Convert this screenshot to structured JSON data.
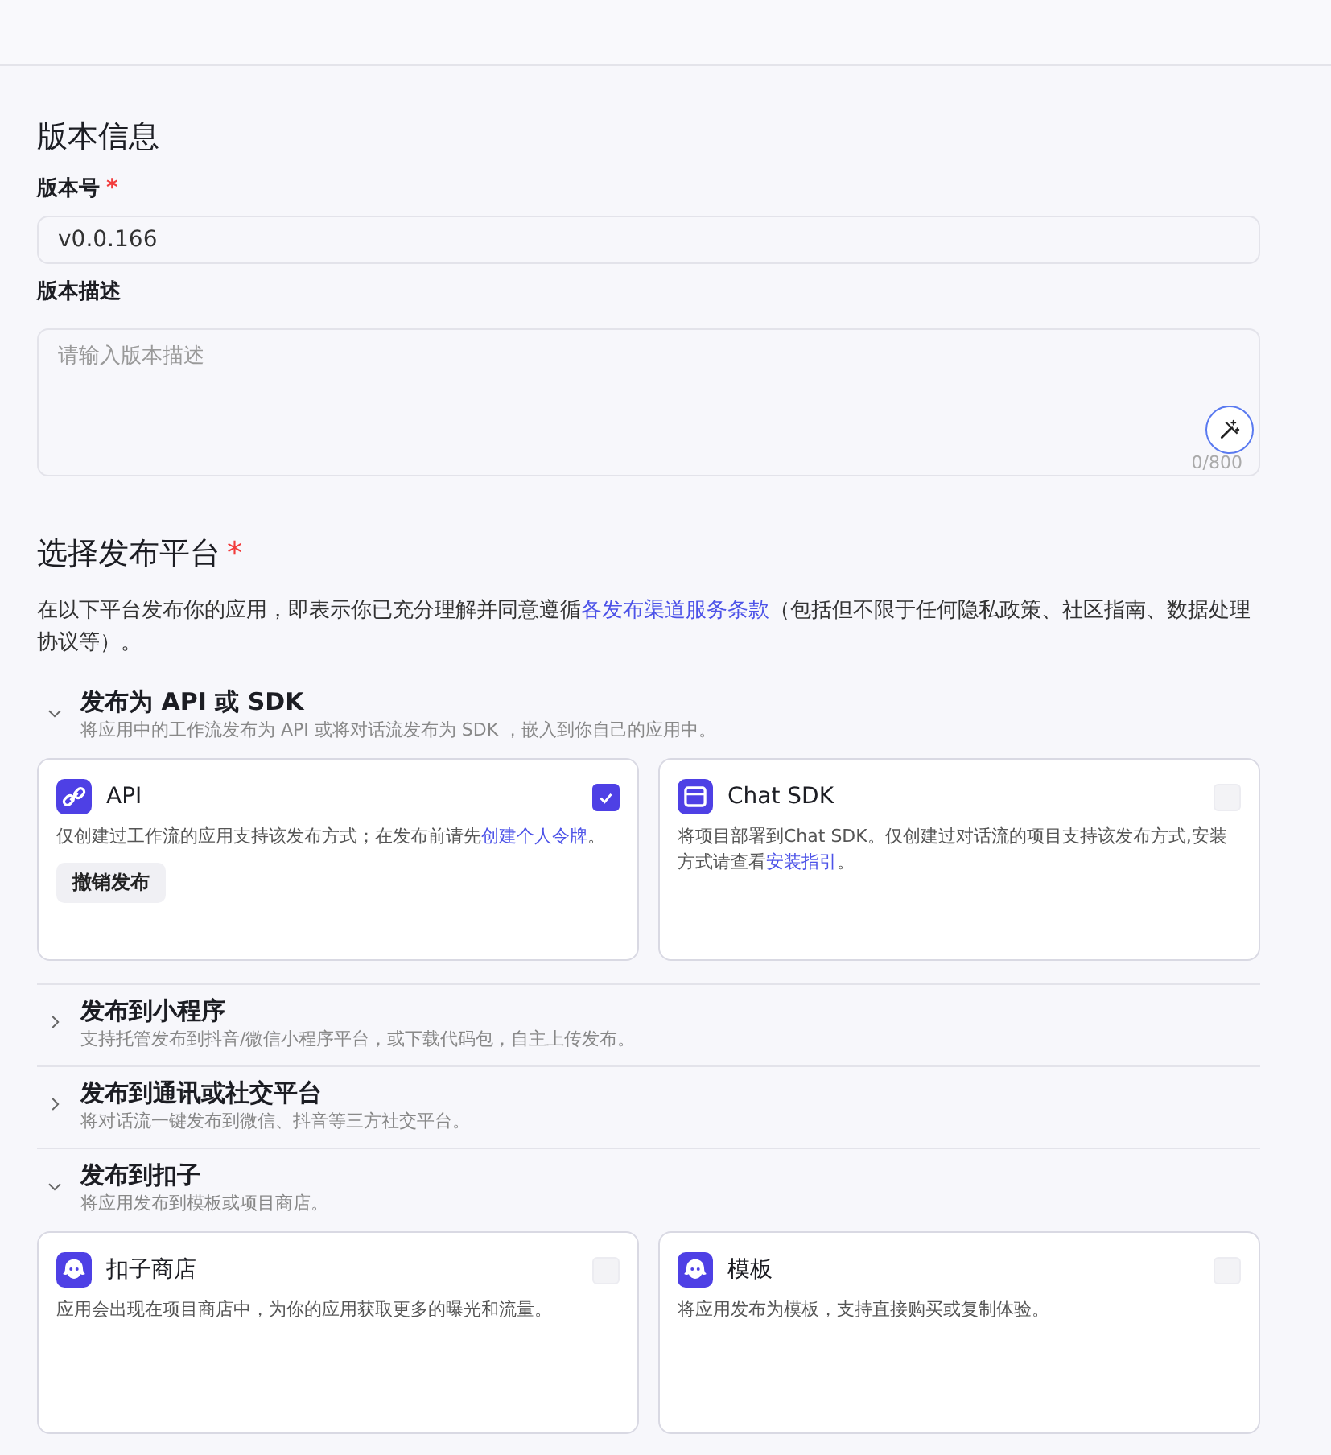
{
  "version_info": {
    "title": "版本信息",
    "version_field": {
      "label": "版本号",
      "required_mark": "*",
      "value": "v0.0.166"
    },
    "description_field": {
      "label": "版本描述",
      "placeholder": "请输入版本描述",
      "counter": "0/800"
    }
  },
  "platforms": {
    "title": "选择发布平台",
    "required_mark": "*",
    "notice": [
      {
        "kind": "text",
        "text": "在以下平台发布你的应用，即表示你已充分理解并同意遵循"
      },
      {
        "kind": "link",
        "text": "各发布渠道服务条款"
      },
      {
        "kind": "text",
        "text": "（包括但不限于任何隐私政策、社区指南、数据处理协议等）。"
      }
    ],
    "groups": [
      {
        "title": "发布为 API 或 SDK",
        "description": "将应用中的工作流发布为 API 或将对话流发布为 SDK ，嵌入到你自己的应用中。",
        "expanded": true,
        "cards": [
          {
            "kind": "link",
            "title": "API",
            "checked": true,
            "description": [
              {
                "kind": "text",
                "text": "仅创建过工作流的应用支持该发布方式；在发布前请先"
              },
              {
                "kind": "link",
                "text": "创建个人令牌"
              },
              {
                "kind": "text",
                "text": "。"
              }
            ],
            "button": "撤销发布"
          },
          {
            "kind": "window",
            "title": "Chat SDK",
            "checked": false,
            "description": [
              {
                "kind": "text",
                "text": "将项目部署到Chat SDK。仅创建过对话流的项目支持该发布方式,安装方式请查看"
              },
              {
                "kind": "link",
                "text": "安装指引"
              },
              {
                "kind": "text",
                "text": "。"
              }
            ]
          }
        ]
      },
      {
        "title": "发布到小程序",
        "description": "支持托管发布到抖音/微信小程序平台，或下载代码包，自主上传发布。",
        "expanded": false
      },
      {
        "title": "发布到通讯或社交平台",
        "description": "将对话流一键发布到微信、抖音等三方社交平台。",
        "expanded": false
      },
      {
        "title": "发布到扣子",
        "description": "将应用发布到模板或项目商店。",
        "expanded": true,
        "cards": [
          {
            "kind": "bot",
            "title": "扣子商店",
            "checked": false,
            "description": [
              {
                "kind": "text",
                "text": "应用会出现在项目商店中，为你的应用获取更多的曝光和流量。"
              }
            ]
          },
          {
            "kind": "bot",
            "title": "模板",
            "checked": false,
            "description": [
              {
                "kind": "text",
                "text": "将应用发布为模板，支持直接购买或复制体验。"
              }
            ]
          }
        ]
      }
    ]
  }
}
